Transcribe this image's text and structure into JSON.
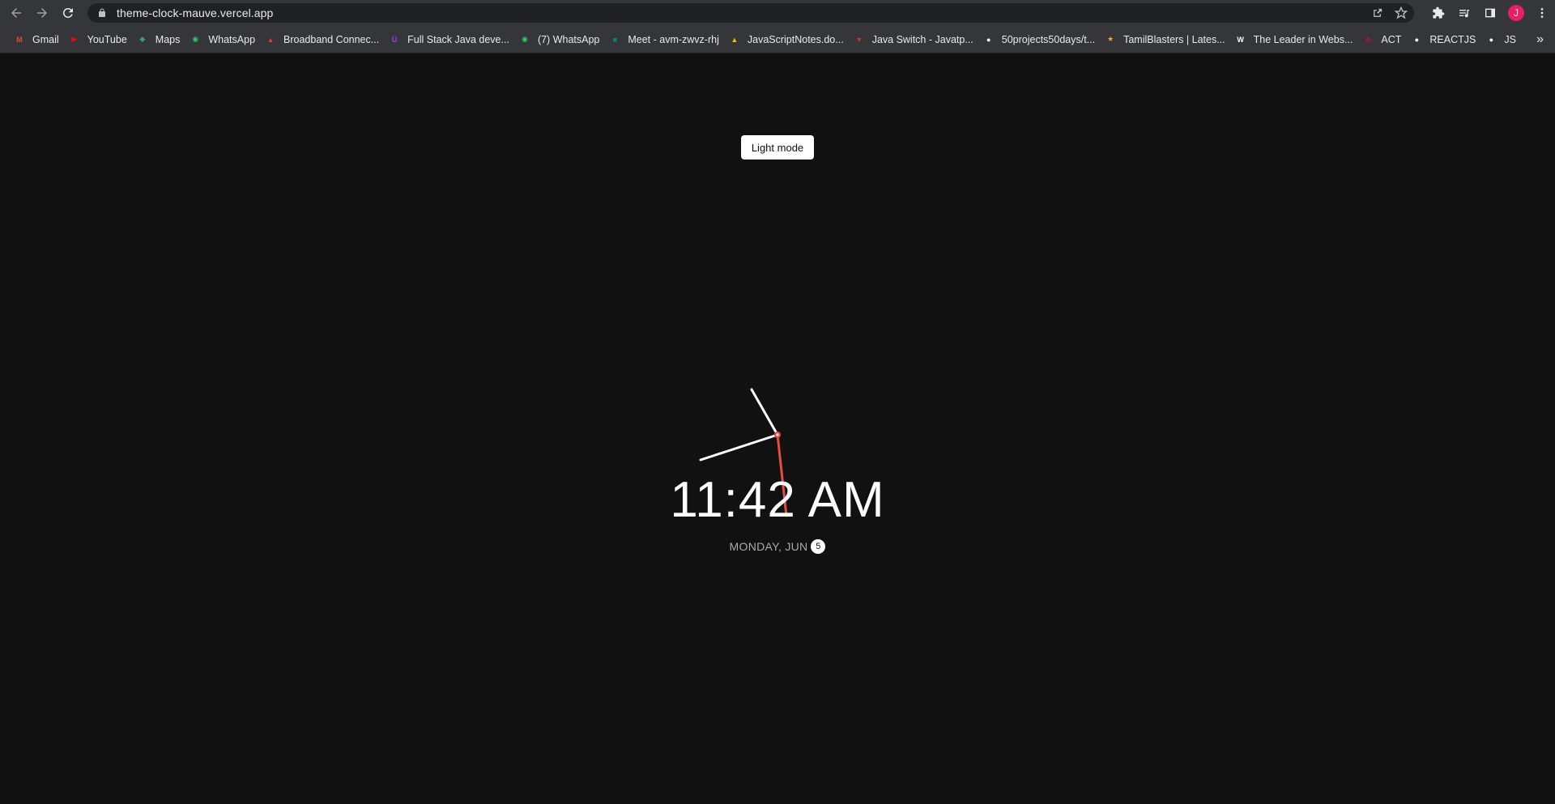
{
  "browser": {
    "url": "theme-clock-mauve.vercel.app",
    "avatar_letter": "J",
    "bookmarks": [
      {
        "label": "Gmail",
        "icon": "gmail-icon",
        "color": "#ea4335"
      },
      {
        "label": "YouTube",
        "icon": "youtube-icon",
        "color": "#ff0000"
      },
      {
        "label": "Maps",
        "icon": "maps-icon",
        "color": "#34a853"
      },
      {
        "label": "WhatsApp",
        "icon": "whatsapp-icon",
        "color": "#25d366"
      },
      {
        "label": "Broadband Connec...",
        "icon": "broadband-icon",
        "color": "#e53935"
      },
      {
        "label": "Full Stack Java deve...",
        "icon": "udemy-icon",
        "color": "#a435f0"
      },
      {
        "label": "(7) WhatsApp",
        "icon": "whatsapp-icon",
        "color": "#25d366"
      },
      {
        "label": "Meet - avm-zwvz-rhj",
        "icon": "meet-icon",
        "color": "#00897b"
      },
      {
        "label": "JavaScriptNotes.do...",
        "icon": "drive-icon",
        "color": "#fbbc04"
      },
      {
        "label": "Java Switch - Javatp...",
        "icon": "javatpoint-icon",
        "color": "#d32f2f"
      },
      {
        "label": "50projects50days/t...",
        "icon": "github-icon",
        "color": "#ffffff"
      },
      {
        "label": "TamilBlasters | Lates...",
        "icon": "tamilblasters-icon",
        "color": "#f9a825"
      },
      {
        "label": "The Leader in Webs...",
        "icon": "wix-icon",
        "color": "#ffffff"
      },
      {
        "label": "ACT",
        "icon": "angular-icon",
        "color": "#dd0031"
      },
      {
        "label": "REACTJS",
        "icon": "github-icon",
        "color": "#ffffff"
      },
      {
        "label": "JS",
        "icon": "github-icon",
        "color": "#ffffff"
      }
    ],
    "more_label": "»"
  },
  "page": {
    "toggle_label": "Light mode",
    "time": "11:42 AM",
    "date_text": "MONDAY, JUN",
    "date_day": "5"
  },
  "colors": {
    "background": "#111111",
    "hand": "#ffffff",
    "second_hand": "#e74c3c"
  }
}
